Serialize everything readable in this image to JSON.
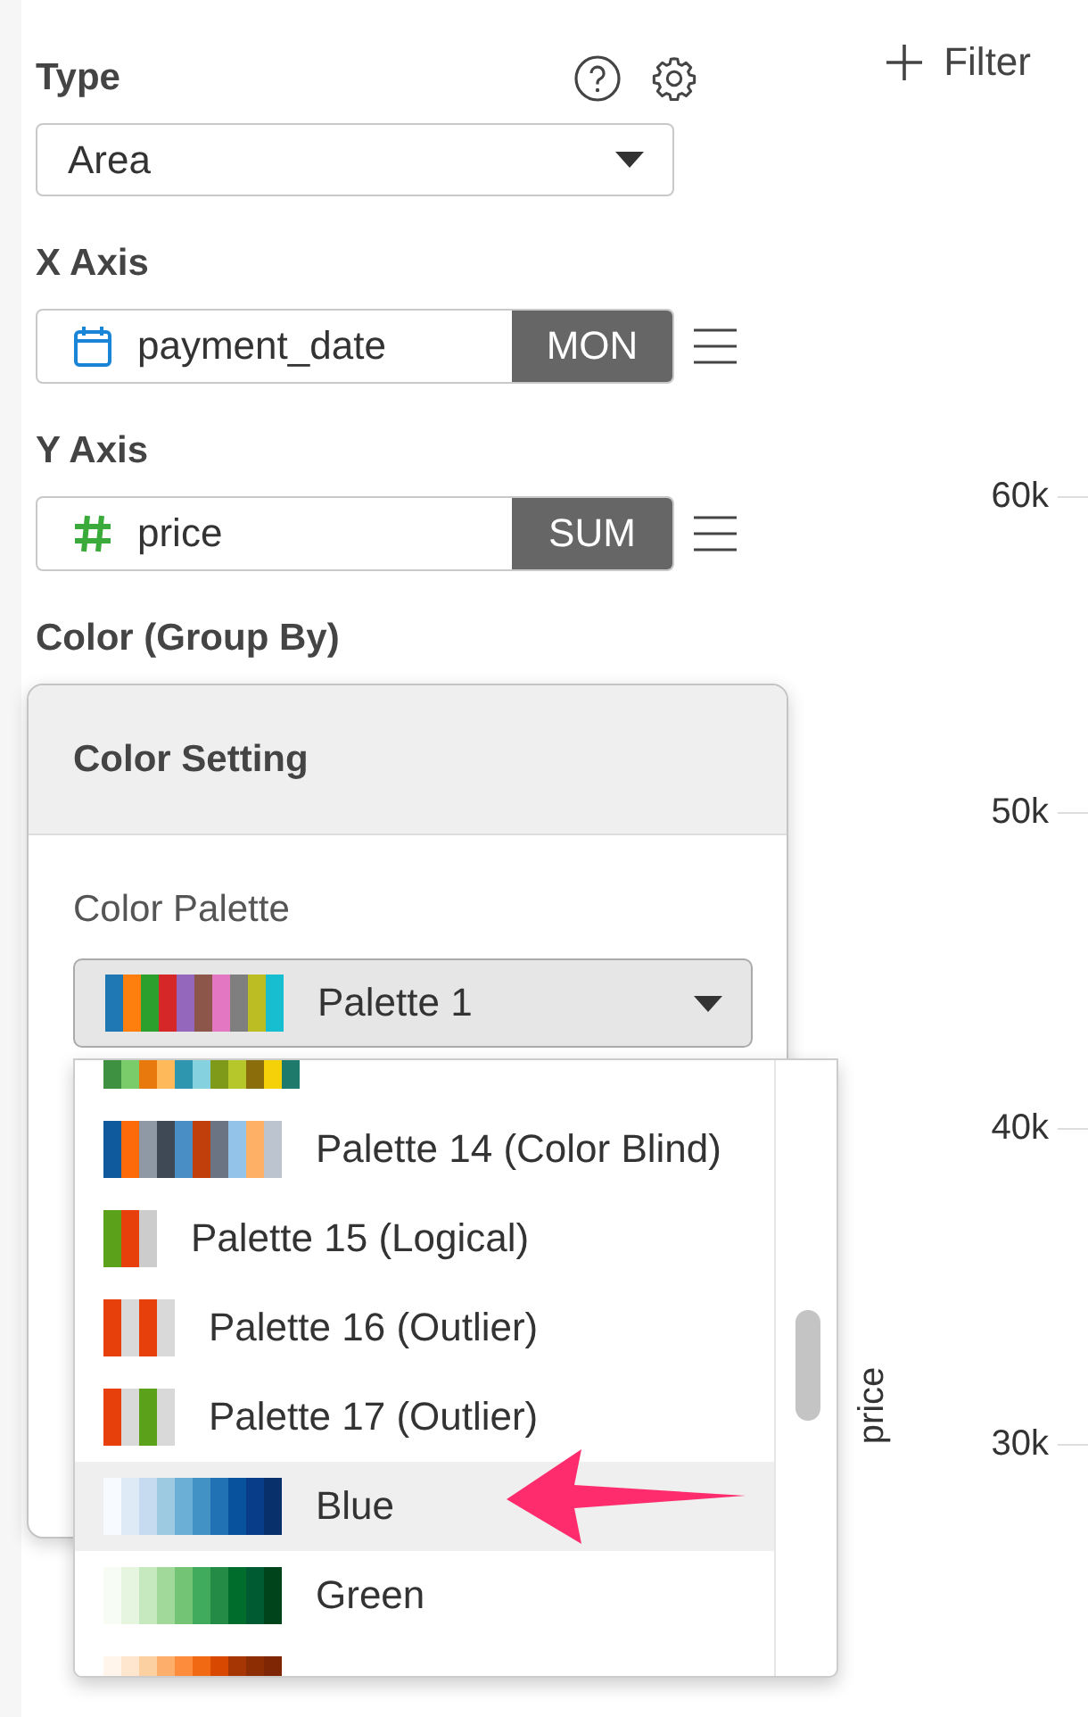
{
  "type_field": {
    "label": "Type",
    "value": "Area"
  },
  "x_axis": {
    "label": "X Axis",
    "field": "payment_date",
    "kind": "date",
    "aggregation": "MON"
  },
  "y_axis": {
    "label": "Y Axis",
    "field": "price",
    "kind": "number",
    "aggregation": "SUM"
  },
  "color_group": {
    "label": "Color (Group By)"
  },
  "filter_button": {
    "label": "Filter"
  },
  "chart": {
    "ylabel": "price",
    "yticks": [
      "60k",
      "50k",
      "40k",
      "30k"
    ]
  },
  "color_setting": {
    "title": "Color Setting",
    "palette_label": "Color Palette",
    "selected_palette": {
      "name": "Palette 1"
    },
    "options": [
      {
        "hovered": false
      },
      {
        "name": "Palette 14 (Color Blind)",
        "hovered": false
      },
      {
        "name": "Palette 15 (Logical)",
        "hovered": false
      },
      {
        "name": "Palette 16 (Outlier)",
        "hovered": false
      },
      {
        "name": "Palette 17 (Outlier)",
        "hovered": false
      },
      {
        "name": "Blue",
        "hovered": true
      },
      {
        "name": "Green",
        "hovered": false
      },
      {
        "hovered": false
      }
    ]
  }
}
